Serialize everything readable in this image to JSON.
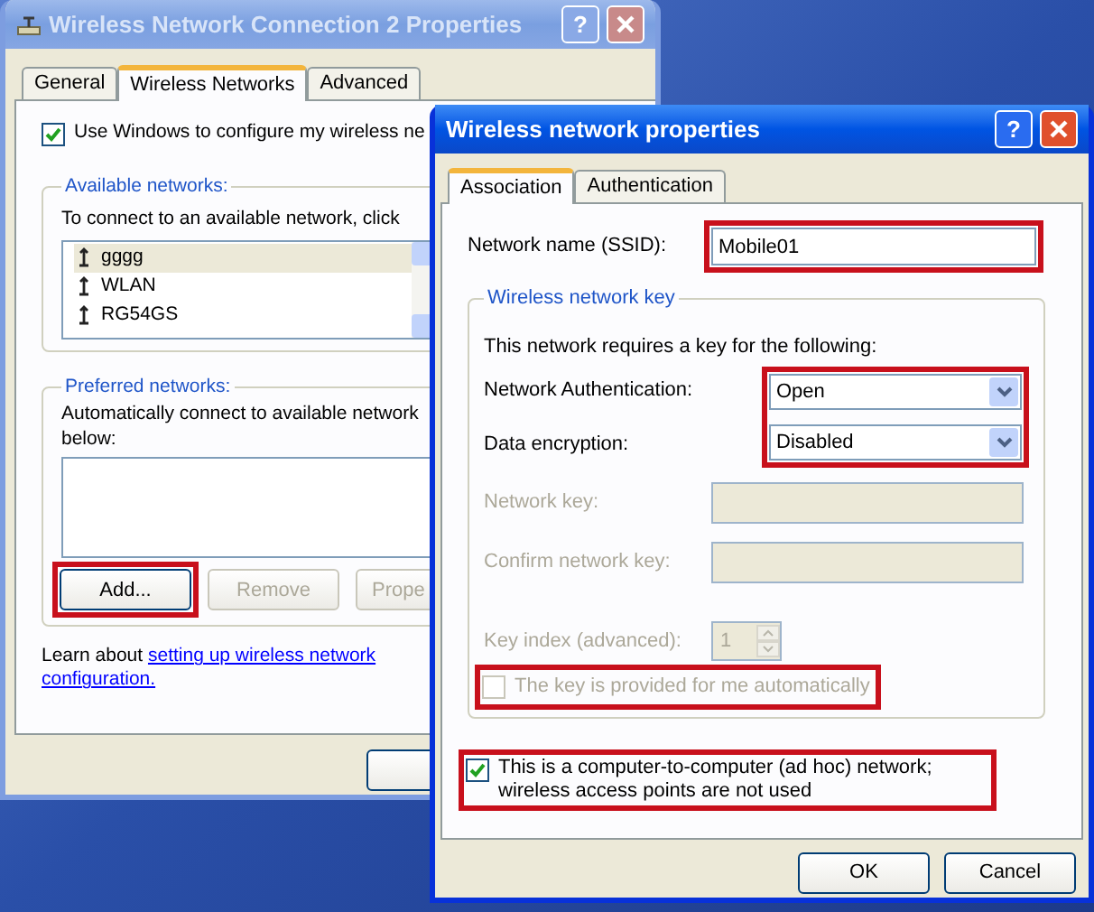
{
  "back_window": {
    "title": "Wireless Network Connection 2 Properties",
    "active": false,
    "help_glyph": "?",
    "tabs": [
      {
        "label": "General",
        "selected": false
      },
      {
        "label": "Wireless Networks",
        "selected": true
      },
      {
        "label": "Advanced",
        "selected": false
      }
    ],
    "use_windows": {
      "label": "Use Windows to configure my wireless ne",
      "checked": true
    },
    "available_networks": {
      "title": "Available networks:",
      "hint": "To connect to an available network, click",
      "networks": [
        {
          "name": "gggg",
          "selected": true
        },
        {
          "name": "WLAN",
          "selected": false
        },
        {
          "name": "RG54GS",
          "selected": false
        }
      ]
    },
    "preferred_networks": {
      "title": "Preferred networks:",
      "hint_lines": [
        "Automatically connect to available network",
        "below:"
      ],
      "buttons": [
        {
          "label": "Add...",
          "disabled": false,
          "highlighted": true
        },
        {
          "label": "Remove",
          "disabled": true,
          "highlighted": false
        },
        {
          "label": "Prope",
          "disabled": true,
          "highlighted": false
        }
      ]
    },
    "learn_more": {
      "text": "Learn about",
      "link_lines": [
        "setting up wireless network",
        "configuration."
      ]
    }
  },
  "front_window": {
    "title": "Wireless network properties",
    "active": true,
    "help_glyph": "?",
    "tabs": [
      {
        "label": "Association",
        "selected": true
      },
      {
        "label": "Authentication",
        "selected": false
      }
    ],
    "ssid": {
      "label": "Network name (SSID):",
      "value": "Mobile01",
      "highlighted": true
    },
    "key_group": {
      "title": "Wireless network key",
      "intro": "This network requires a key for the following:",
      "selectors_highlighted": true,
      "selectors": [
        {
          "label": "Network Authentication:",
          "value": "Open"
        },
        {
          "label": "Data encryption:",
          "value": "Disabled"
        }
      ],
      "key_fields": [
        {
          "label": "Network key:",
          "disabled": true
        },
        {
          "label": "Confirm network key:",
          "disabled": true
        }
      ],
      "key_index": {
        "label": "Key index (advanced):",
        "value": "1",
        "disabled": true
      },
      "auto_key": {
        "label": "The key is provided for me automatically",
        "checked": false,
        "disabled": true,
        "highlighted": true
      }
    },
    "ad_hoc": {
      "label": "This is a computer-to-computer (ad hoc) network; wireless access points are not used",
      "checked": true,
      "disabled": false,
      "highlighted": true
    },
    "buttons": [
      {
        "label": "OK"
      },
      {
        "label": "Cancel"
      }
    ]
  }
}
